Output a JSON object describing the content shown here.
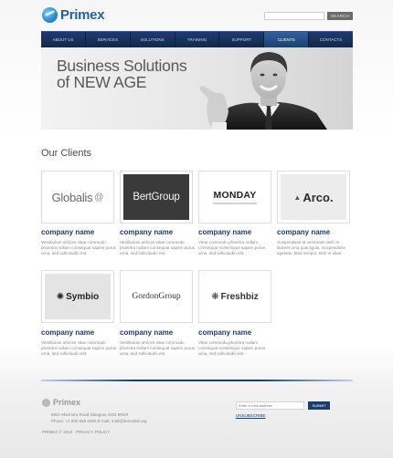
{
  "header": {
    "logo_text": "Primex",
    "search_placeholder": "",
    "search_button": "SEARCH"
  },
  "nav": {
    "items": [
      "ABOUT US",
      "SERVICES",
      "SOLUTIONS",
      "TRAINING",
      "SUPPORT",
      "CLIENTS",
      "CONTACTS"
    ],
    "active": "CLIENTS"
  },
  "banner": {
    "line1": "Business Solutions",
    "line2": "of NEW AGE"
  },
  "clients": {
    "title": "Our Clients",
    "items": [
      {
        "logo": "Globalis",
        "name": "company name",
        "desc": "Vestibulum ultrices vitae commodo pharetra nullam consequat sapien purus urna, sed sollicitudin est."
      },
      {
        "logo": "BertGroup",
        "name": "company name",
        "desc": "Vestibulum ultrices vitae commodo pharetra nullam consequat sapien purus urna, sed sollicitudin est."
      },
      {
        "logo": "MONDAY",
        "name": "company name",
        "desc": "Vitae commodo pharetra nullam consequat scelerisque sapien purus urna, sed sollicitudin est."
      },
      {
        "logo": "Arco.",
        "name": "company name",
        "desc": "Suspendisse et venenatis velit. In laoreet urna quis ligula. Suspendisse egestas. Duis tempor, nibh in vitae."
      },
      {
        "logo": "Symbio",
        "name": "company name",
        "desc": "Vestibulum ultrices vitae commodo pharetra nullam consequat sapien purus urna, sed sollicitudin est."
      },
      {
        "logo": "GordonGroup",
        "name": "company name",
        "desc": "Vestibulum ultrices vitae commodo pharetra nullam consequat sapien purus urna, sed sollicitudin est."
      },
      {
        "logo": "Freshbiz",
        "name": "company name",
        "desc": "Vitae commodo pharetra nullam consequat scelerisque sapien purus urna, sed sollicitudin est."
      }
    ]
  },
  "footer": {
    "logo_text": "Primex",
    "address": "8901 Marmora Road Glasgow, DO4 89GR",
    "contact": "Phone: +1 800 559 6580   E-mail: mail@demolink.org",
    "copyright": "PRIMEX © 2012 · PRIVACY POLICY",
    "newsletter_placeholder": "Enter e-mail address",
    "subscribe_button": "SUBMIT",
    "unsubscribe": "UNSUBSCRIBE"
  },
  "colors": {
    "brand": "#1d3c6a",
    "accent_blue": "#2c8fd4"
  }
}
